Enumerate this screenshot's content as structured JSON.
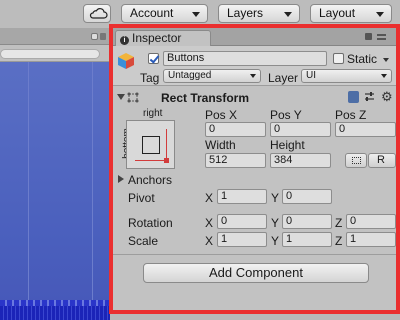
{
  "toolbar": {
    "account_label": "Account",
    "layers_label": "Layers",
    "layout_label": "Layout"
  },
  "inspector": {
    "tab_label": "Inspector",
    "info_glyph": "i",
    "object_name": "Buttons",
    "static_label": "Static",
    "tag_label": "Tag",
    "tag_value": "Untagged",
    "layer_label": "Layer",
    "layer_value": "UI"
  },
  "rect_transform": {
    "title": "Rect Transform",
    "anchor_right_label": "right",
    "anchor_bottom_label": "bottom",
    "pos_x_label": "Pos X",
    "pos_y_label": "Pos Y",
    "pos_z_label": "Pos Z",
    "pos_x": "0",
    "pos_y": "0",
    "pos_z": "0",
    "width_label": "Width",
    "height_label": "Height",
    "width": "512",
    "height": "384",
    "raw_label": "R",
    "anchors_label": "Anchors",
    "pivot_label": "Pivot",
    "pivot_x": "1",
    "pivot_y": "0",
    "rotation_label": "Rotation",
    "rotation_x": "0",
    "rotation_y": "0",
    "rotation_z": "0",
    "scale_label": "Scale",
    "scale_x": "1",
    "scale_y": "1",
    "scale_z": "1",
    "x_axis": "X",
    "y_axis": "Y",
    "z_axis": "Z"
  },
  "add_component_label": "Add Component",
  "colors": {
    "highlight": "#ea2f2f",
    "panel_bg": "#c2c2c2",
    "scene_blue": "#4a5fbd"
  },
  "icons": [
    "cloud-icon",
    "info-icon",
    "lock-icon",
    "menu-icon",
    "gameobject-cube-icon",
    "rect-transform-icon",
    "book-icon",
    "sliders-icon",
    "gear-icon",
    "anchor-preset-icon",
    "blueprint-icon"
  ]
}
